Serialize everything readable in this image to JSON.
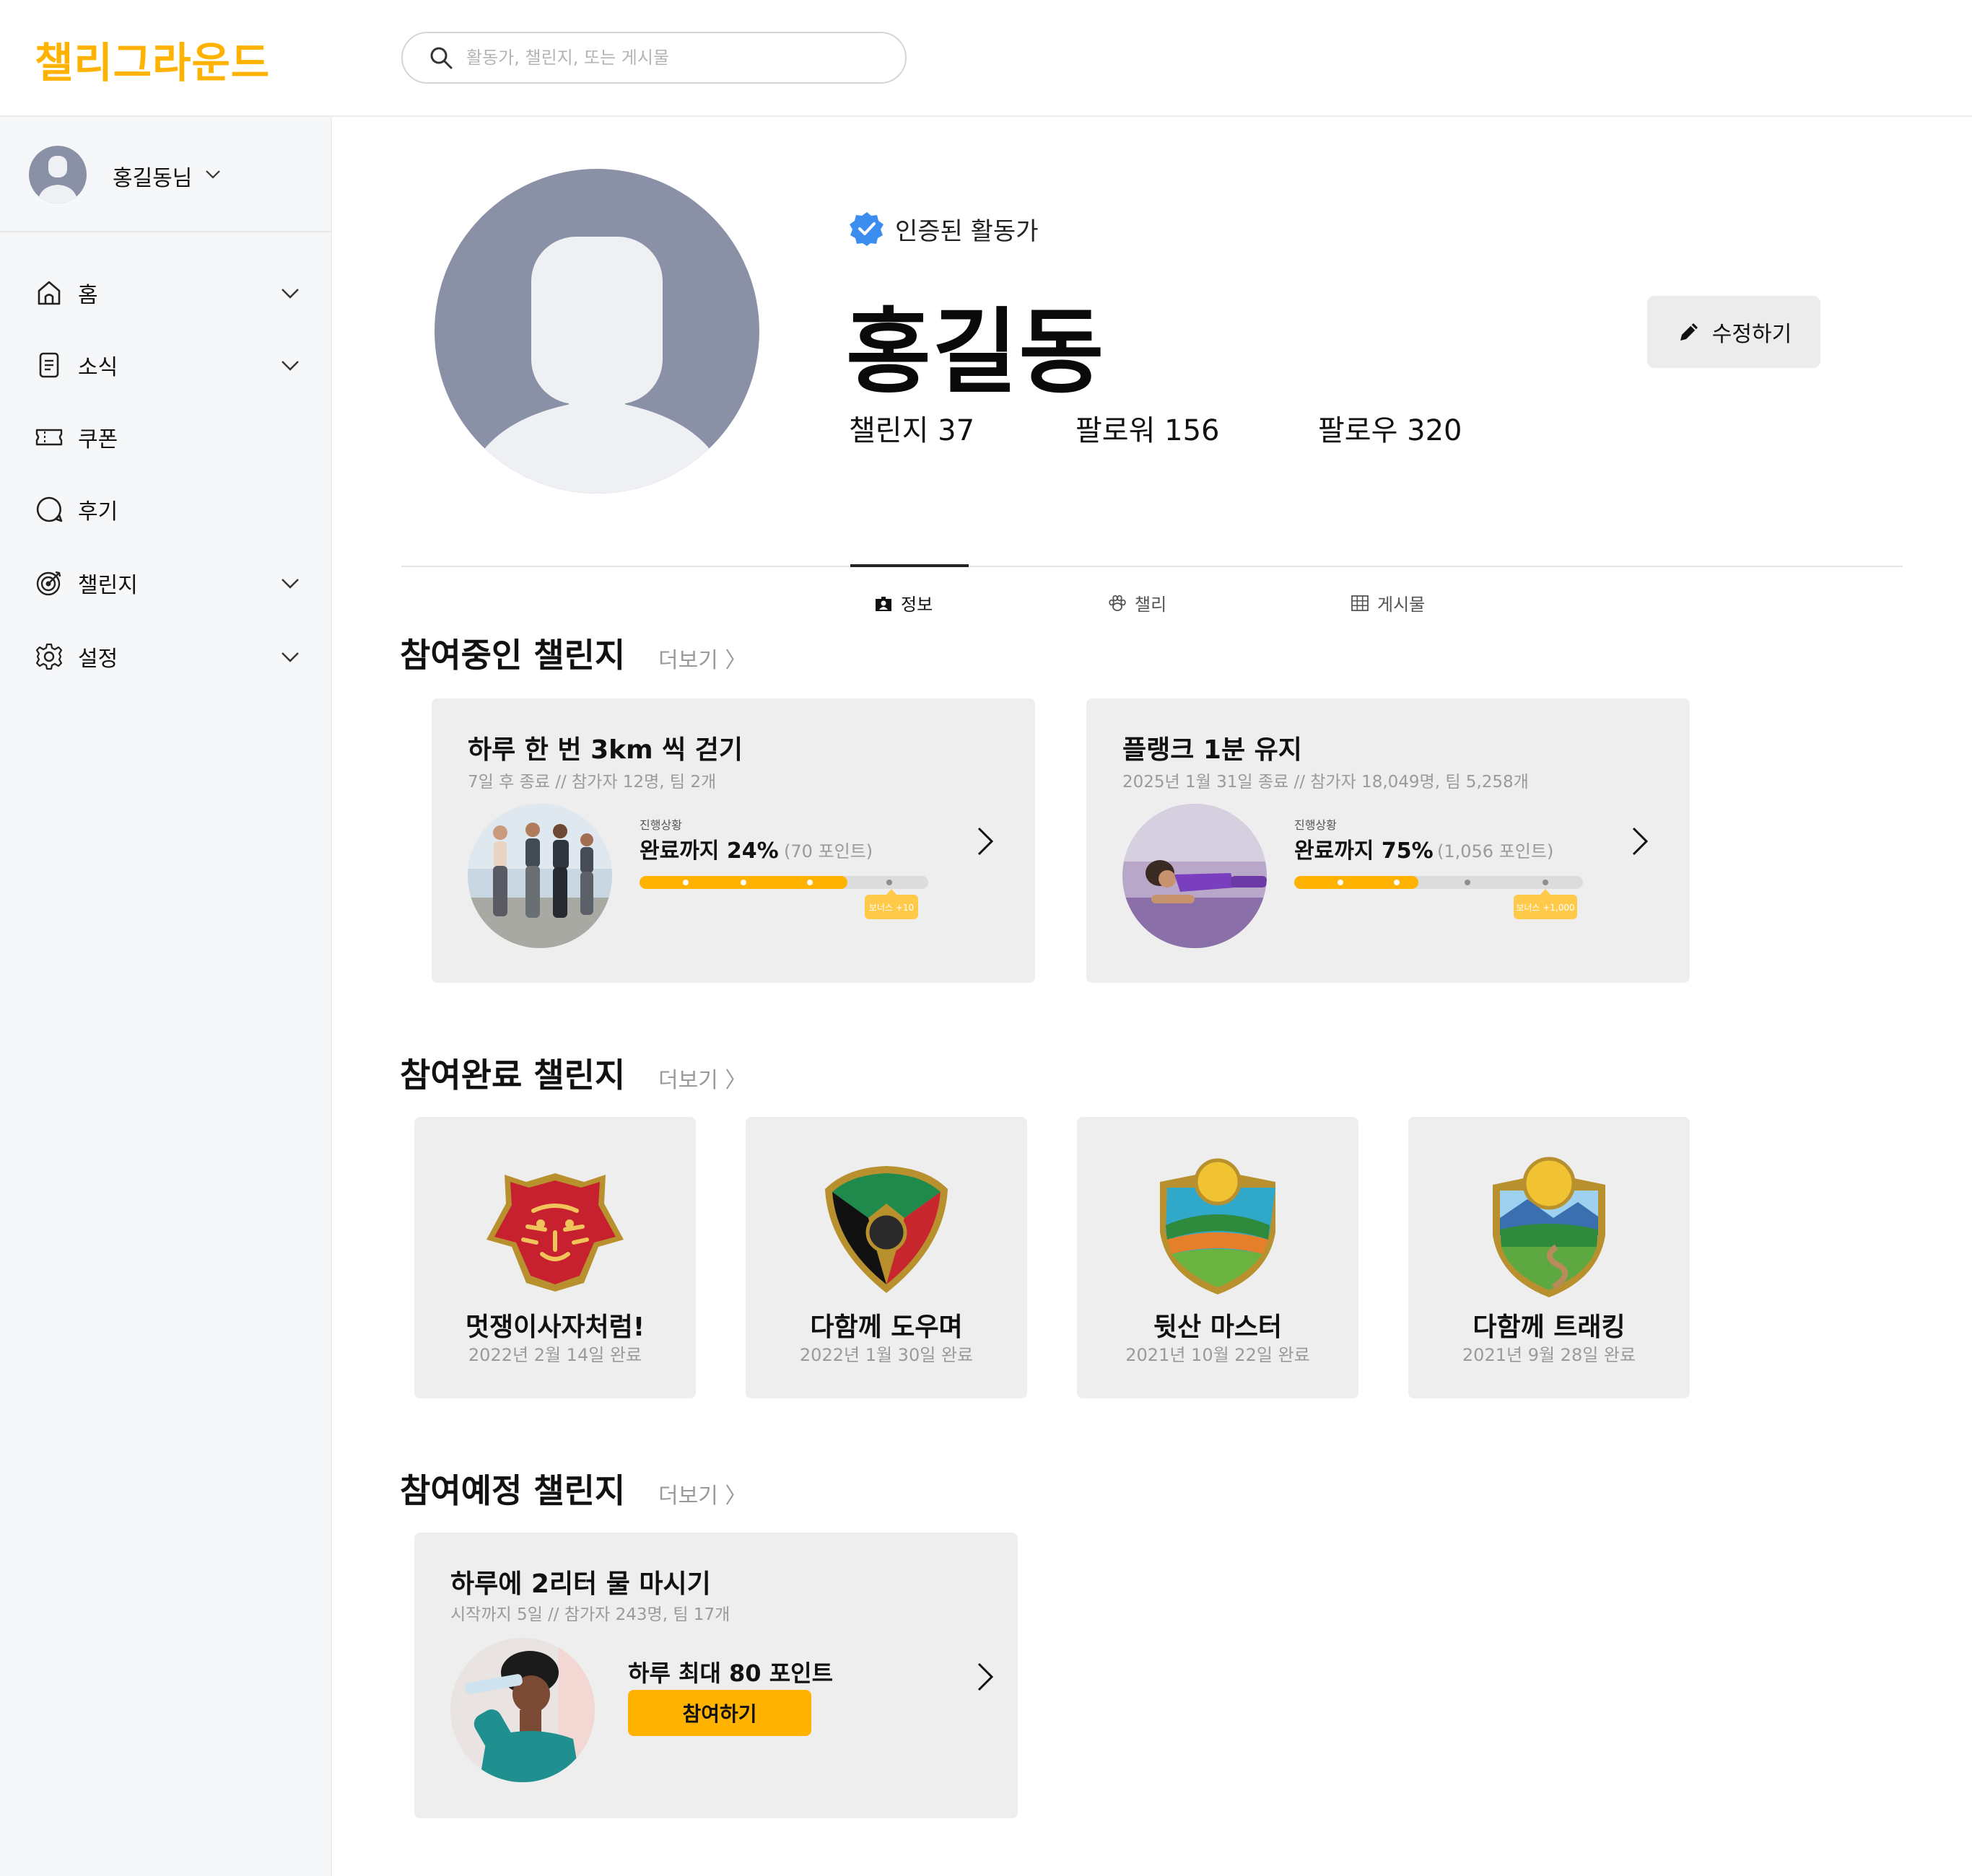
{
  "header": {
    "logo": "챌리그라운드",
    "search_placeholder": "활동가, 챌린지, 또는 게시물"
  },
  "sidebar": {
    "user_name": "홍길동님",
    "items": [
      {
        "label": "홈",
        "icon": "home-icon",
        "expandable": true
      },
      {
        "label": "소식",
        "icon": "document-icon",
        "expandable": true
      },
      {
        "label": "쿠폰",
        "icon": "ticket-icon",
        "expandable": false
      },
      {
        "label": "후기",
        "icon": "chat-bubble-icon",
        "expandable": false
      },
      {
        "label": "챌린지",
        "icon": "target-icon",
        "expandable": true
      },
      {
        "label": "설정",
        "icon": "gear-icon",
        "expandable": true
      }
    ]
  },
  "profile": {
    "verified_label": "인증된 활동가",
    "name": "홍길동",
    "edit_label": "수정하기",
    "stats": {
      "challenges": "챌린지 37",
      "followers": "팔로워 156",
      "following": "팔로우 320"
    }
  },
  "tabs": [
    {
      "label": "정보",
      "icon": "id-card-icon",
      "active": true
    },
    {
      "label": "챌리",
      "icon": "paw-icon",
      "active": false
    },
    {
      "label": "게시물",
      "icon": "grid-icon",
      "active": false
    }
  ],
  "more_label": "더보기 〉",
  "ongoing": {
    "title": "참여중인 챌린지",
    "cards": [
      {
        "title": "하루 한 번 3km 씩 걷기",
        "sub": "7일 후 종료  //  참가자 12명, 팀 2개",
        "progress_label": "진행상황",
        "progress_main": "완료까지 24%",
        "progress_points": "(70 포인트)",
        "progress": 0.72,
        "bonus": "보너스 +10"
      },
      {
        "title": "플랭크 1분 유지",
        "sub": "2025년 1월 31일 종료  //  참가자 18,049명, 팀 5,258개",
        "progress_label": "진행상황",
        "progress_main": "완료까지 75%",
        "progress_points": "(1,056 포인트)",
        "progress": 0.43,
        "bonus": "보너스 +1,000"
      }
    ]
  },
  "completed": {
    "title": "참여완료 챌린지",
    "badges": [
      {
        "title": "멋쟁이사자처럼!",
        "date": "2022년 2월 14일 완료",
        "icon": "tiger-badge-icon"
      },
      {
        "title": "다함께 도우며",
        "date": "2022년 1월 30일 완료",
        "icon": "hands-badge-icon"
      },
      {
        "title": "뒷산 마스터",
        "date": "2021년 10월 22일 완료",
        "icon": "hill-badge-icon"
      },
      {
        "title": "다함께 트래킹",
        "date": "2021년 9월 28일 완료",
        "icon": "mountain-badge-icon"
      }
    ]
  },
  "upcoming": {
    "title": "참여예정 챌린지",
    "card": {
      "title": "하루에 2리터 물 마시기",
      "sub": "시작까지 5일  //  참가자 243명, 팀 17개",
      "points": "하루 최대 80 포인트",
      "join_label": "참여하기"
    }
  },
  "colors": {
    "accent": "#ffb300",
    "avatar_bg": "#8a90a6",
    "card_bg": "#eeeeee",
    "verified": "#3b8ef0"
  }
}
